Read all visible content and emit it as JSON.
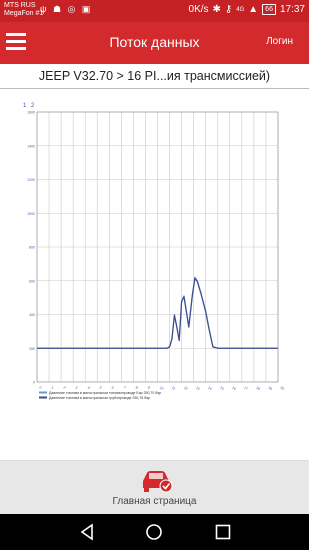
{
  "status_bar": {
    "carrier_1": "MTS RUS",
    "carrier_2": "MegaFon #1",
    "net_speed": "0K/s",
    "network": "4G",
    "battery": "66",
    "time": "17:37"
  },
  "header": {
    "title": "Поток данных",
    "login_label": "Логин"
  },
  "breadcrumb": "JEEP V32.70 > 16 PI...ия трансмиссией)",
  "chart_controls": {
    "btn_1": "1",
    "btn_2": "2"
  },
  "footer": {
    "home_label": "Главная страница"
  },
  "colors": {
    "brand": "#d32a2e",
    "series_1": "#6a9ad8",
    "series_2": "#404a8a"
  },
  "chart_data": {
    "type": "line",
    "ylim": [
      0,
      1600
    ],
    "ytick_labels": [
      "0",
      "200",
      "400",
      "600",
      "800",
      "1000",
      "1200",
      "1400",
      "1600"
    ],
    "xtick_labels": [
      "0",
      "1",
      "2",
      "3",
      "4",
      "5",
      "6",
      "7",
      "8",
      "9",
      "10",
      "11",
      "12",
      "13",
      "14",
      "15",
      "16",
      "17",
      "18",
      "19",
      "20"
    ],
    "grid": true,
    "legend_position": "bottom-left",
    "series": [
      {
        "name": "Давление топлива в магистральном топливопроводе  Бар  250,70 бар",
        "x": [
          0,
          10.8,
          11,
          11.2,
          11.4,
          11.6,
          11.8,
          12,
          12.2,
          12.6,
          12.9,
          13.1,
          13.3,
          13.6,
          14,
          14.3,
          14.6,
          15,
          20
        ],
        "y": [
          201,
          201,
          210,
          260,
          400,
          330,
          250,
          480,
          510,
          330,
          520,
          620,
          600,
          530,
          420,
          310,
          210,
          201,
          201
        ]
      },
      {
        "name": "Давление топлива в магистральном трубопроводе 250,78 бар",
        "x": [
          0,
          10.8,
          11,
          11.2,
          11.4,
          11.6,
          11.8,
          12,
          12.2,
          12.6,
          12.9,
          13.1,
          13.3,
          13.6,
          14,
          14.3,
          14.6,
          15,
          20
        ],
        "y": [
          200,
          200,
          208,
          255,
          395,
          325,
          245,
          475,
          505,
          325,
          515,
          615,
          595,
          525,
          415,
          305,
          208,
          200,
          200
        ]
      }
    ]
  }
}
